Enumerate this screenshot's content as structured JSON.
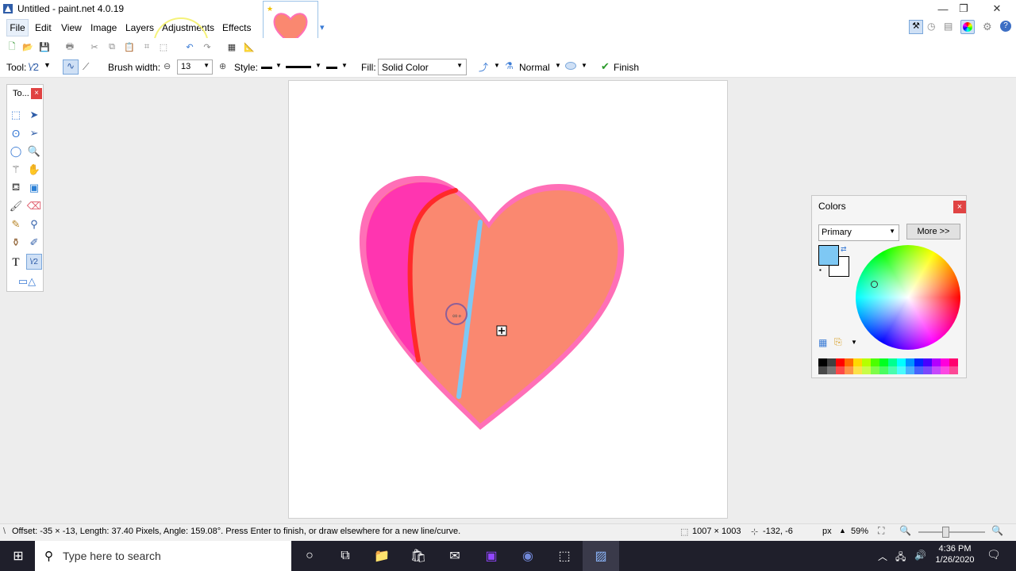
{
  "window": {
    "title": "Untitled - paint.net 4.0.19"
  },
  "menu": [
    "File",
    "Edit",
    "View",
    "Image",
    "Layers",
    "Adjustments",
    "Effects"
  ],
  "toolbar": {
    "tool_label": "Tool:",
    "brush_width_label": "Brush width:",
    "brush_width_value": "13",
    "style_label": "Style:",
    "fill_label": "Fill:",
    "fill_value": "Solid Color",
    "blend_mode": "Normal",
    "finish_label": "Finish"
  },
  "tools_panel": {
    "title": "To..."
  },
  "colors_panel": {
    "title": "Colors",
    "selector_value": "Primary",
    "more_button": "More >>",
    "primary_color": "#7ec8f4",
    "secondary_color": "#ffffff",
    "palette": [
      "#000000",
      "#404040",
      "#ff0000",
      "#ff6a00",
      "#ffd800",
      "#b6ff00",
      "#4cff00",
      "#00ff21",
      "#00ff90",
      "#00ffff",
      "#0094ff",
      "#0026ff",
      "#4800ff",
      "#b200ff",
      "#ff00dc",
      "#ff006e"
    ]
  },
  "status": {
    "message": "Offset: -35 × -13, Length: 37.40 Pixels, Angle: 159.08°. Press Enter to finish, or draw elsewhere for a new line/curve.",
    "image_size": "1007 × 1003",
    "cursor_pos": "-132, -6",
    "units": "px",
    "zoom": "59%"
  },
  "taskbar": {
    "search_placeholder": "Type here to search",
    "time": "4:36 PM",
    "date": "1/26/2020"
  },
  "colors": {
    "heart_fill": "#fa8870",
    "heart_border": "#ff5fb6",
    "heart_left": "#ff35b0",
    "red_stroke": "#ff2a2a",
    "blue_line": "#7ec8f4"
  }
}
